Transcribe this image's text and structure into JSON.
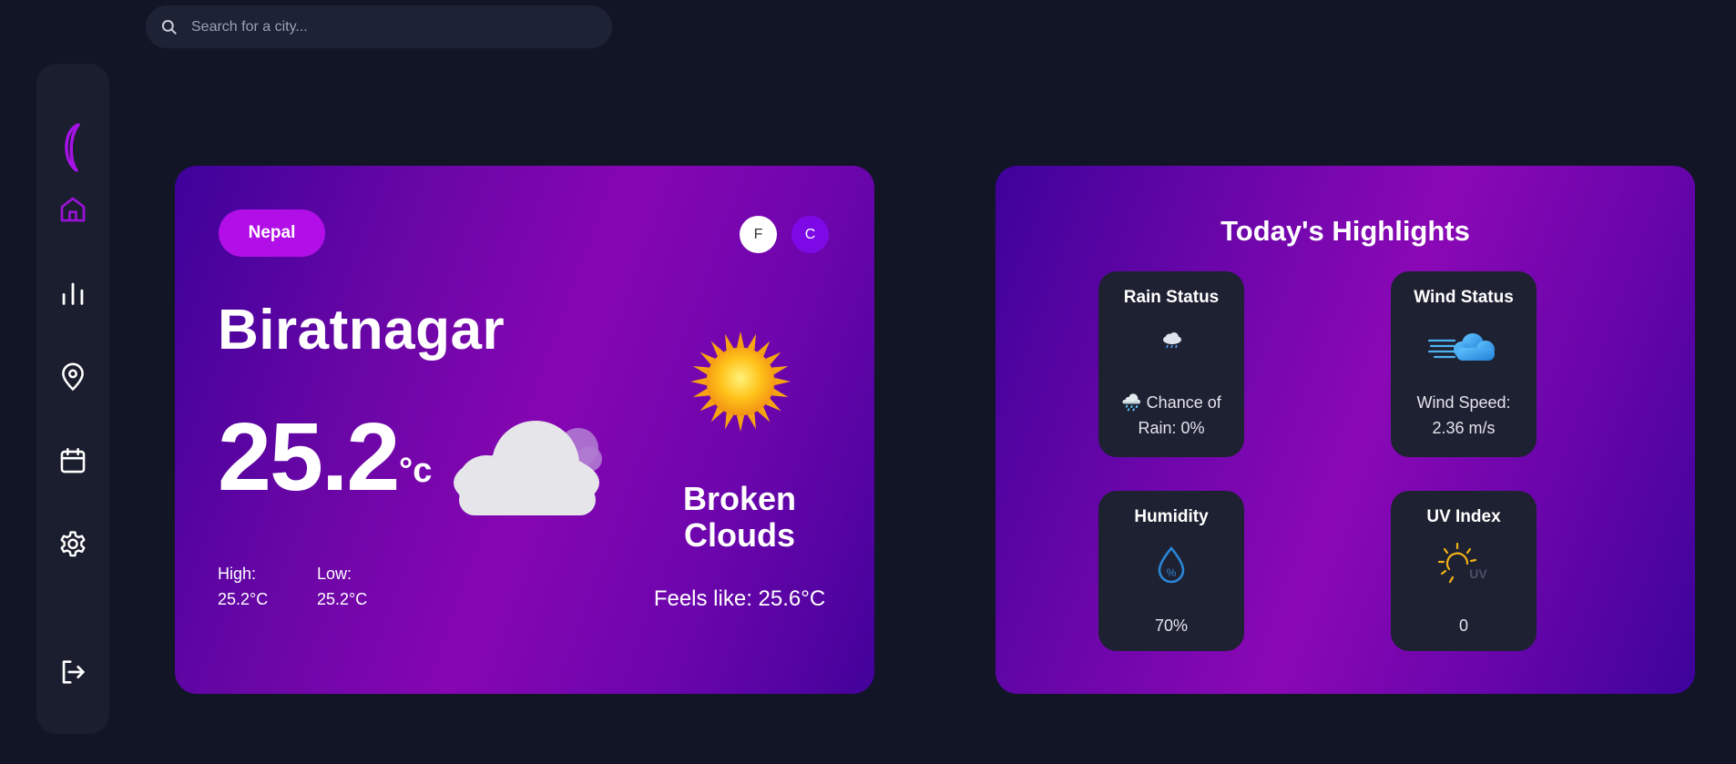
{
  "search": {
    "placeholder": "Search for a city..."
  },
  "sidebar": {
    "items": [
      {
        "icon": "moon-logo-icon"
      },
      {
        "icon": "home-icon",
        "active": true
      },
      {
        "icon": "bar-chart-icon"
      },
      {
        "icon": "location-pin-icon"
      },
      {
        "icon": "calendar-icon"
      },
      {
        "icon": "settings-gear-icon"
      },
      {
        "icon": "logout-icon"
      }
    ],
    "accent_color": "#9b11d8"
  },
  "weather": {
    "country": "Nepal",
    "unit_f": "F",
    "unit_c": "C",
    "city": "Biratnagar",
    "temperature": "25.2",
    "temp_unit": "°c",
    "high_label": "High:",
    "high_value": "25.2°C",
    "low_label": "Low:",
    "low_value": "25.2°C",
    "condition_line1": "Broken",
    "condition_line2": "Clouds",
    "feels_like": "Feels like: 25.6°C"
  },
  "highlights": {
    "title": "Today's Highlights",
    "rain": {
      "title": "Rain Status",
      "line1": "🌧️ Chance of",
      "line2": "Rain: 0%"
    },
    "wind": {
      "title": "Wind Status",
      "line1": "Wind Speed:",
      "line2": "2.36 m/s"
    },
    "humidity": {
      "title": "Humidity",
      "value": "70%"
    },
    "uv": {
      "title": "UV Index",
      "value": "0",
      "icon_label": "UV"
    }
  }
}
